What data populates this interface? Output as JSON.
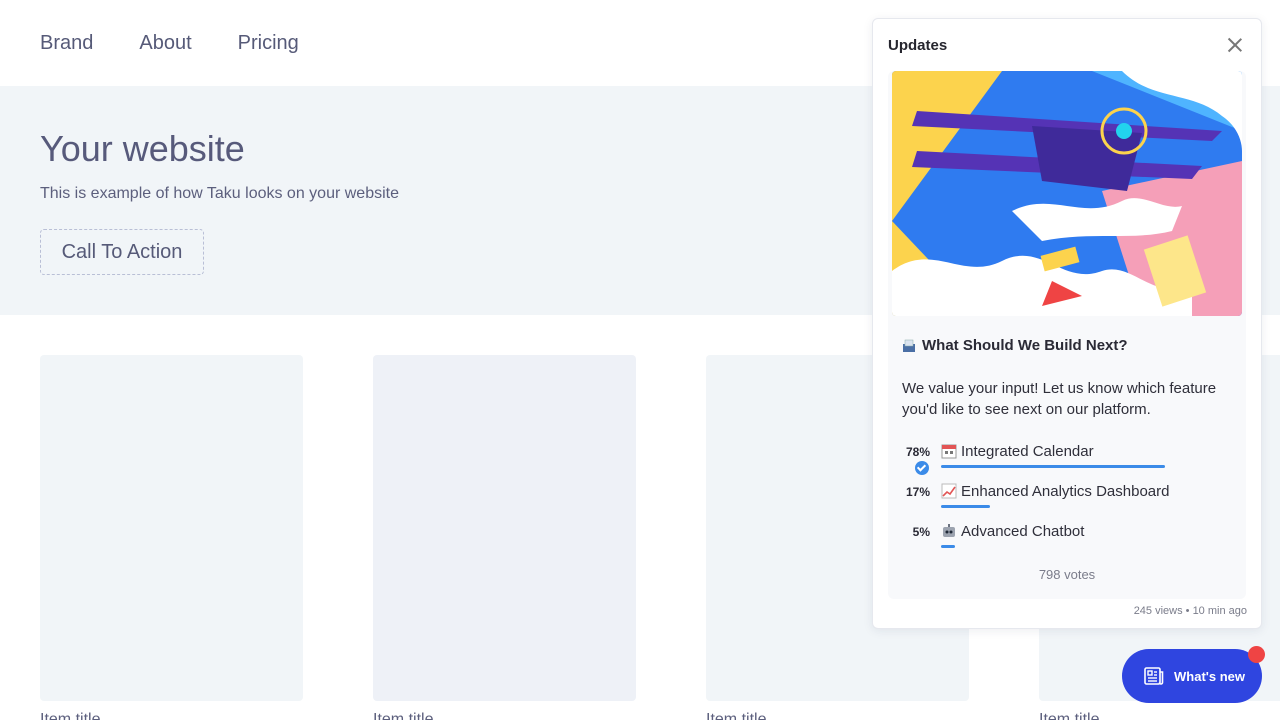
{
  "nav": {
    "brand": "Brand",
    "about": "About",
    "pricing": "Pricing"
  },
  "hero": {
    "title": "Your website",
    "subtitle": "This is example of how Taku looks on your website",
    "cta": "Call To Action"
  },
  "cards": [
    {
      "title": "Item title",
      "color": "#f1f5f8"
    },
    {
      "title": "Item title",
      "color": "#eef1f7"
    },
    {
      "title": "Item title",
      "color": "#f1f5f8"
    },
    {
      "title": "Item title",
      "color": "#f1f5f8"
    }
  ],
  "panel": {
    "title": "Updates",
    "post": {
      "title": "What Should We Build Next?",
      "body": "We value your input! Let us know which feature you'd like to see next on our platform.",
      "options": [
        {
          "percent": "78%",
          "share": 0.78,
          "label": "Integrated Calendar",
          "icon": "calendar-icon",
          "selected": true
        },
        {
          "percent": "17%",
          "share": 0.17,
          "label": "Enhanced Analytics Dashboard",
          "icon": "chart-increasing-icon",
          "selected": false
        },
        {
          "percent": "5%",
          "share": 0.05,
          "label": "Advanced Chatbot",
          "icon": "robot-icon",
          "selected": false
        }
      ],
      "votes": "798 votes"
    },
    "meta": "245 views • 10 min ago"
  },
  "whats_new": {
    "label": "What's new"
  },
  "colors": {
    "accent": "#3b8be8",
    "button": "#2f45e0",
    "badge": "#ef4444"
  }
}
